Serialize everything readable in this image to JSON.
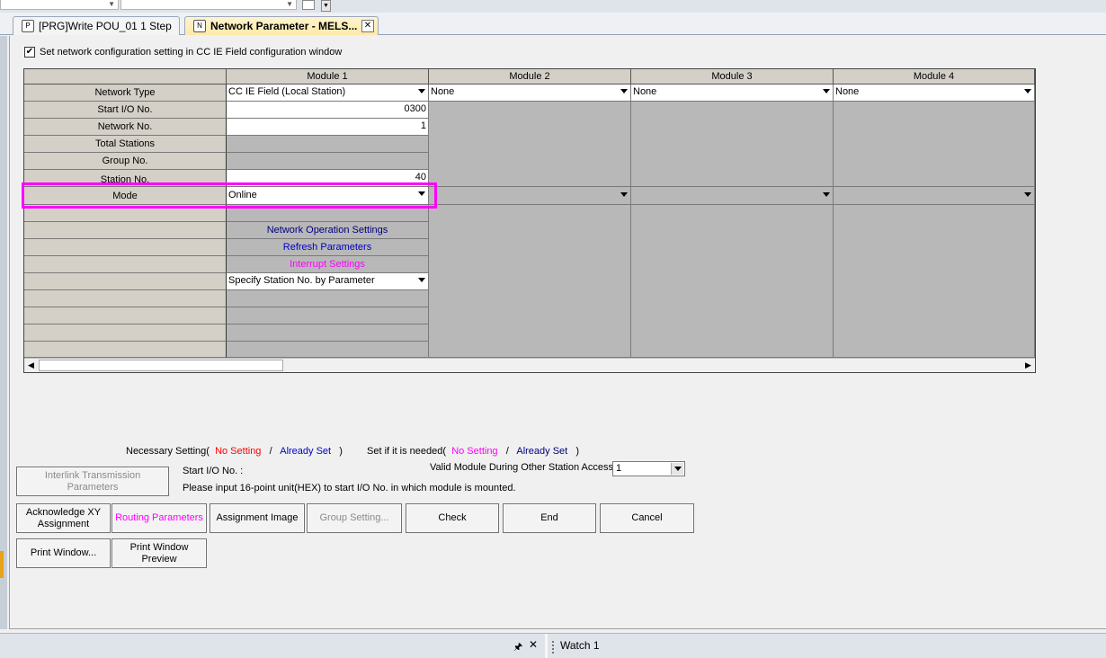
{
  "tabs": [
    {
      "label": "[PRG]Write POU_01 1 Step",
      "icon": "program-icon"
    },
    {
      "label": "Network Parameter - MELS...",
      "icon": "network-icon",
      "close": "✕"
    }
  ],
  "checkbox": {
    "label": "Set network configuration setting in CC IE Field configuration window",
    "checked": true
  },
  "grid": {
    "columns": [
      "Module 1",
      "Module 2",
      "Module 3",
      "Module 4"
    ],
    "rows": [
      "Network Type",
      "Start I/O No.",
      "Network No.",
      "Total Stations",
      "Group No.",
      "Station No.",
      "Mode"
    ],
    "network_type": [
      "CC IE Field (Local Station)",
      "None",
      "None",
      "None"
    ],
    "start_io": "0300",
    "network_no": "1",
    "station_no": "40",
    "mode": "Online",
    "links": {
      "network_operation": "Network Operation Settings",
      "refresh": "Refresh Parameters",
      "interrupt": "Interrupt Settings"
    },
    "station_spec": "Specify Station No. by Parameter"
  },
  "legend": {
    "necessary_prefix": "Necessary Setting(",
    "no_setting": "No Setting",
    "slash": "/",
    "already_set": "Already Set",
    "close": ")",
    "ifneeded_prefix": "Set if it is needed(",
    "no_setting2": "No Setting",
    "already_set2": "Already Set",
    "close2": ")"
  },
  "info": {
    "start_io_label": "Start I/O No. :",
    "hint": "Please input 16-point unit(HEX) to start I/O No. in which module is mounted.",
    "valid_module_label": "Valid Module During Other Station Access",
    "valid_module_value": "1"
  },
  "buttons": {
    "interlink": "Interlink Transmission Parameters",
    "ack_xy": "Acknowledge XY Assignment",
    "routing": "Routing Parameters",
    "assignment_image": "Assignment Image",
    "group_setting": "Group Setting...",
    "check": "Check",
    "end": "End",
    "cancel": "Cancel",
    "print_window": "Print Window...",
    "print_preview": "Print Window Preview"
  },
  "bottom": {
    "pin": "🖈",
    "close": "✕",
    "watch": "Watch 1"
  }
}
